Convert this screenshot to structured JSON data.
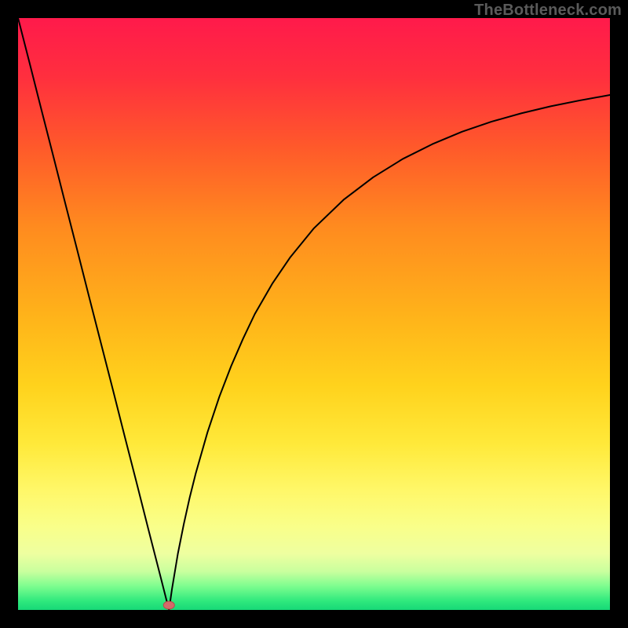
{
  "watermark": "TheBottleneck.com",
  "colors": {
    "frame": "#000000",
    "curve": "#000000",
    "marker_fill": "#d46a6a",
    "marker_stroke": "#b94a4a",
    "gradient_stops": [
      {
        "offset": 0.0,
        "color": "#ff1a4b"
      },
      {
        "offset": 0.1,
        "color": "#ff2f3e"
      },
      {
        "offset": 0.22,
        "color": "#ff5a2a"
      },
      {
        "offset": 0.35,
        "color": "#ff8a1f"
      },
      {
        "offset": 0.5,
        "color": "#ffb21a"
      },
      {
        "offset": 0.62,
        "color": "#ffd21c"
      },
      {
        "offset": 0.72,
        "color": "#ffe93a"
      },
      {
        "offset": 0.8,
        "color": "#fff86a"
      },
      {
        "offset": 0.86,
        "color": "#f9ff8a"
      },
      {
        "offset": 0.905,
        "color": "#eeffa0"
      },
      {
        "offset": 0.935,
        "color": "#c9ff9e"
      },
      {
        "offset": 0.96,
        "color": "#7dfd8f"
      },
      {
        "offset": 0.985,
        "color": "#2fe97d"
      },
      {
        "offset": 1.0,
        "color": "#17d877"
      }
    ]
  },
  "chart_data": {
    "type": "line",
    "title": "",
    "xlabel": "",
    "ylabel": "",
    "xlim": [
      0,
      100
    ],
    "ylim": [
      0,
      100
    ],
    "grid": false,
    "legend": false,
    "marker": {
      "x": 25.5,
      "y": 0.8
    },
    "series": [
      {
        "name": "left-branch",
        "x": [
          0,
          2,
          4,
          6,
          8,
          10,
          12,
          14,
          16,
          18,
          20,
          22,
          24,
          25.5
        ],
        "values": [
          100,
          92.2,
          84.3,
          76.5,
          68.6,
          60.8,
          52.9,
          45.1,
          37.3,
          29.4,
          21.6,
          13.7,
          5.9,
          0
        ]
      },
      {
        "name": "right-branch",
        "x": [
          25.5,
          26,
          27,
          28,
          29,
          30,
          32,
          34,
          36,
          38,
          40,
          43,
          46,
          50,
          55,
          60,
          65,
          70,
          75,
          80,
          85,
          90,
          95,
          100
        ],
        "values": [
          0,
          3.5,
          9.5,
          14.5,
          19.0,
          23.0,
          30.0,
          36.0,
          41.2,
          45.8,
          50.0,
          55.2,
          59.6,
          64.5,
          69.3,
          73.1,
          76.2,
          78.7,
          80.8,
          82.5,
          83.9,
          85.1,
          86.1,
          87.0
        ]
      }
    ]
  }
}
